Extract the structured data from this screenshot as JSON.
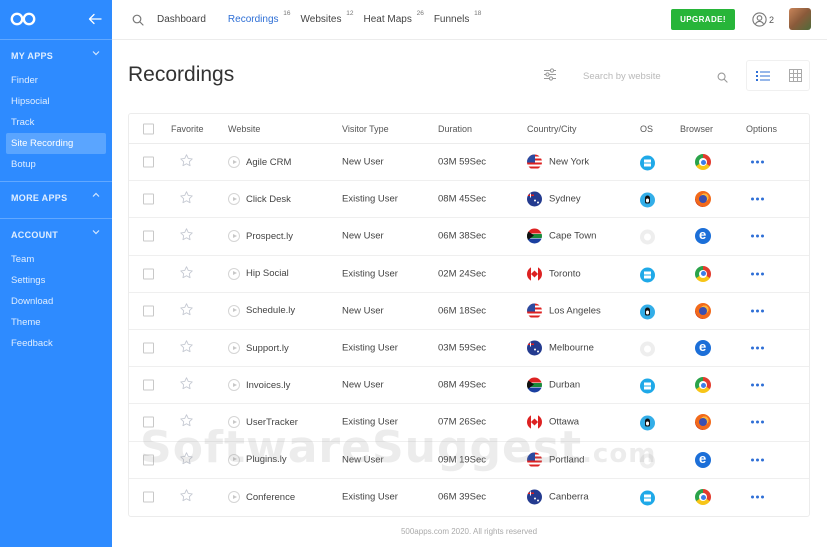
{
  "sidebar": {
    "sections": [
      {
        "label": "MY APPS",
        "items": [
          "Finder",
          "Hipsocial",
          "Track",
          "Site Recording",
          "Botup"
        ],
        "active": "Site Recording"
      },
      {
        "label": "MORE APPS",
        "items": []
      },
      {
        "label": "ACCOUNT",
        "items": [
          "Team",
          "Settings",
          "Download",
          "Theme",
          "Feedback"
        ]
      }
    ]
  },
  "topnav": {
    "items": [
      {
        "label": "Dashboard",
        "count": ""
      },
      {
        "label": "Recordings",
        "count": "16"
      },
      {
        "label": "Websites",
        "count": "12"
      },
      {
        "label": "Heat Maps",
        "count": "26"
      },
      {
        "label": "Funnels",
        "count": "18"
      }
    ],
    "active": "Recordings",
    "upgrade_label": "UPGRADE!",
    "user_count": "2"
  },
  "main": {
    "title": "Recordings",
    "search_placeholder": "Search by website"
  },
  "table": {
    "columns": [
      "Favorite",
      "Website",
      "Visitor Type",
      "Duration",
      "Country/City",
      "OS",
      "Browser",
      "Options"
    ],
    "rows": [
      {
        "website": "Agile CRM",
        "visitor": "New User",
        "duration": "03M 59Sec",
        "flag": "us",
        "city": "New York",
        "os": "windows",
        "browser": "chrome"
      },
      {
        "website": "Click Desk",
        "visitor": "Existing User",
        "duration": "08M 45Sec",
        "flag": "au",
        "city": "Sydney",
        "os": "linux",
        "browser": "firefox"
      },
      {
        "website": "Prospect.ly",
        "visitor": "New User",
        "duration": "06M 38Sec",
        "flag": "za",
        "city": "Cape Town",
        "os": "mac",
        "browser": "ie"
      },
      {
        "website": "Hip Social",
        "visitor": "Existing User",
        "duration": "02M 24Sec",
        "flag": "ca",
        "city": "Toronto",
        "os": "windows",
        "browser": "chrome"
      },
      {
        "website": "Schedule.ly",
        "visitor": "New User",
        "duration": "06M 18Sec",
        "flag": "us",
        "city": "Los Angeles",
        "os": "linux",
        "browser": "firefox"
      },
      {
        "website": "Support.ly",
        "visitor": "Existing User",
        "duration": "03M 59Sec",
        "flag": "au",
        "city": "Melbourne",
        "os": "mac",
        "browser": "ie"
      },
      {
        "website": "Invoices.ly",
        "visitor": "New User",
        "duration": "08M 49Sec",
        "flag": "za",
        "city": "Durban",
        "os": "windows",
        "browser": "chrome"
      },
      {
        "website": "UserTracker",
        "visitor": "Existing User",
        "duration": "07M 26Sec",
        "flag": "ca",
        "city": "Ottawa",
        "os": "linux",
        "browser": "firefox"
      },
      {
        "website": "Plugins.ly",
        "visitor": "New User",
        "duration": "09M 19Sec",
        "flag": "us",
        "city": "Portland",
        "os": "mac",
        "browser": "ie"
      },
      {
        "website": "Conference",
        "visitor": "Existing User",
        "duration": "06M 39Sec",
        "flag": "au",
        "city": "Canberra",
        "os": "windows",
        "browser": "chrome"
      }
    ]
  },
  "footer": "500apps.com 2020. All rights reserved",
  "watermark": {
    "main": "SoftwareSuggest",
    "suffix": ".com"
  },
  "colors": {
    "sidebar": "#2e8bff",
    "upgrade": "#27b539",
    "accent": "#2e6fd6"
  }
}
